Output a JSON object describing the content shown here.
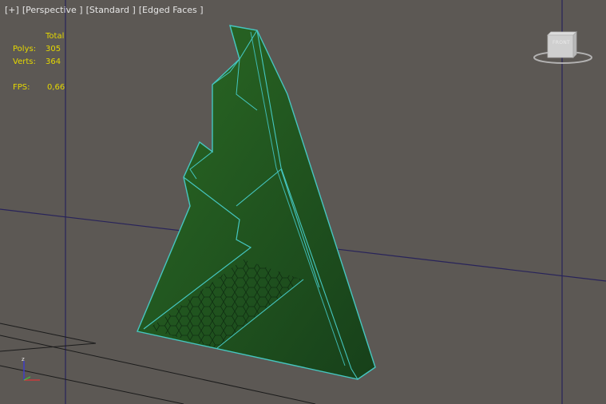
{
  "viewport": {
    "labels": [
      "[+]",
      "[Perspective ]",
      "[Standard ]",
      "[Edged Faces ]"
    ]
  },
  "stats": {
    "header": "Total",
    "polys_label": "Polys:",
    "polys_value": "305",
    "verts_label": "Verts:",
    "verts_value": "364",
    "fps_label": "FPS:",
    "fps_value": "0,66"
  },
  "viewcube": {
    "label": "FRONT"
  },
  "axis_tripod": {
    "z_label": "z"
  },
  "colors": {
    "background": "#5c5854",
    "grid_line": "#2a2460",
    "model_fill": "#1f4f1c",
    "model_fill_light": "#2b6a24",
    "edge_highlight": "#45c6c0",
    "stats_text": "#e5d800"
  }
}
